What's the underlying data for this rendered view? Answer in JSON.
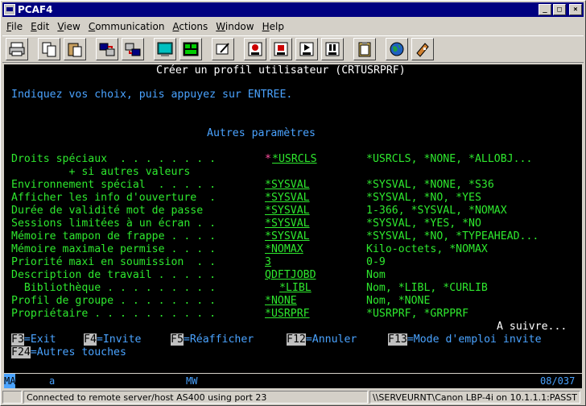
{
  "window": {
    "title": "PCAF4"
  },
  "menu": [
    "File",
    "Edit",
    "View",
    "Communication",
    "Actions",
    "Window",
    "Help"
  ],
  "menu_mnemonics": [
    "F",
    "E",
    "V",
    "C",
    "A",
    "W",
    "H"
  ],
  "toolbar": [
    "print-icon",
    "copy-icon",
    "paste-icon",
    "send-icon",
    "receive-icon",
    "display-setup-icon",
    "keyboard-map-icon",
    "edit-icon",
    "macro-record-icon",
    "macro-stop-icon",
    "macro-play-icon",
    "macro-pause-icon",
    "clipboard-icon",
    "globe-icon",
    "help-icon"
  ],
  "screen": {
    "title": "Créer un profil utilisateur (CRTUSRPRF)",
    "instructions": "Indiquez vos choix, puis appuyez sur ENTREE.",
    "section": "Autres paramètres",
    "fields": [
      {
        "label": "Droits spéciaux  . . . . . . . .",
        "value": "*USRCLS",
        "options": "*USRCLS, *NONE, *ALLOBJ..."
      },
      {
        "label": "         + si autres valeurs",
        "value": "",
        "options": ""
      },
      {
        "label": "Environnement spécial  . . . . .",
        "value": "*SYSVAL",
        "options": "*SYSVAL, *NONE, *S36"
      },
      {
        "label": "Afficher les info d'ouverture  .",
        "value": "*SYSVAL",
        "options": "*SYSVAL, *NO, *YES"
      },
      {
        "label": "Durée de validité mot de passe  ",
        "value": "*SYSVAL",
        "options": "1-366, *SYSVAL, *NOMAX"
      },
      {
        "label": "Sessions limitées à un écran . .",
        "value": "*SYSVAL",
        "options": "*SYSVAL, *YES, *NO"
      },
      {
        "label": "Mémoire tampon de frappe . . . .",
        "value": "*SYSVAL",
        "options": "*SYSVAL, *NO, *TYPEAHEAD..."
      },
      {
        "label": "Mémoire maximale permise . . . .",
        "value": "*NOMAX",
        "options": "Kilo-octets, *NOMAX"
      },
      {
        "label": "Priorité maxi en soumission  . .",
        "value": "3",
        "options": "0-9"
      },
      {
        "label": "Description de travail . . . . .",
        "value": "QDFTJOBD",
        "options": "Nom"
      },
      {
        "label": "  Bibliothèque . . . . . . . . .",
        "value": "*LIBL",
        "options": "Nom, *LIBL, *CURLIB"
      },
      {
        "label": "Profil de groupe . . . . . . . .",
        "value": "*NONE",
        "options": "Nom, *NONE"
      },
      {
        "label": "Propriétaire . . . . . . . . . .",
        "value": "*USRPRF",
        "options": "*USRPRF, *GRPPRF"
      }
    ],
    "more": "A suivre...",
    "fkeys_row1": [
      {
        "key": "F3",
        "label": "=Exit"
      },
      {
        "key": "F4",
        "label": "=Invite"
      },
      {
        "key": "F5",
        "label": "=Réafficher"
      },
      {
        "key": "F12",
        "label": "=Annuler"
      },
      {
        "key": "F13",
        "label": "=Mode d'emploi invite"
      }
    ],
    "fkeys_row2": [
      {
        "key": "F24",
        "label": "=Autres touches"
      }
    ]
  },
  "oia": {
    "mode": "MA",
    "indicator": "a",
    "session": "MW",
    "cursor": "08/037"
  },
  "status": {
    "left": "",
    "connection": "Connected to remote server/host AS400 using port 23",
    "printer": "\\\\SERVEURNT\\Canon LBP-4i on 10.1.1.1:PASST"
  }
}
